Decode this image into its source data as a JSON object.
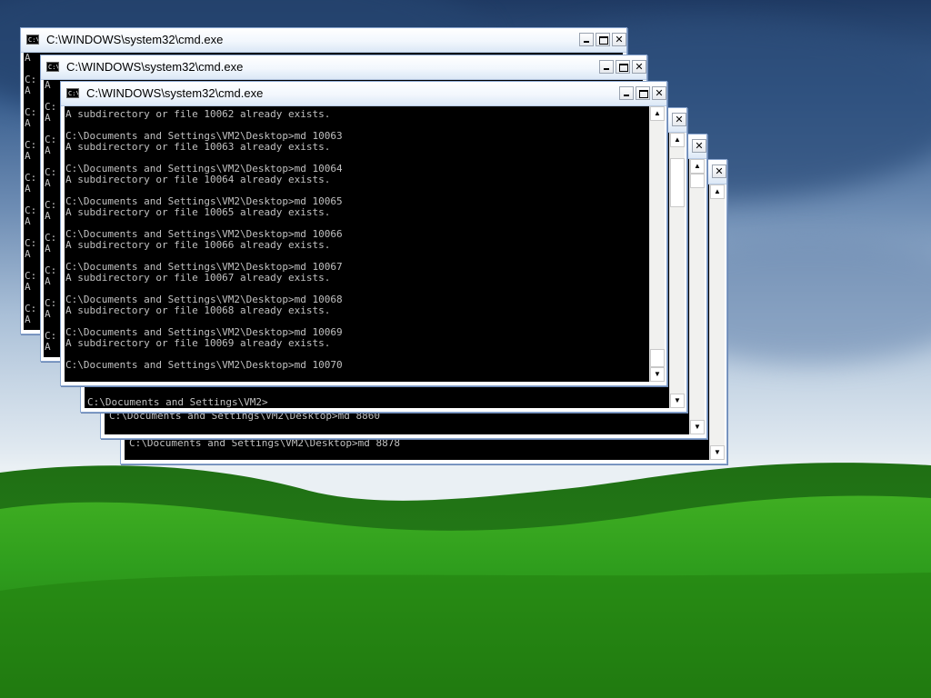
{
  "colors": {
    "desktop_sky": "#3a5f8f",
    "grass": "#2f9e1d",
    "console_bg": "#000000",
    "console_text": "#c0c0c0"
  },
  "icons": {
    "window_icon": "cmd-icon",
    "minimize": "minimize-icon",
    "maximize": "maximize-icon",
    "close": "close-icon",
    "scroll_up": "arrow-up-icon",
    "scroll_down": "arrow-down-icon"
  },
  "windows": [
    {
      "title": "C:\\WINDOWS\\system32\\cmd.exe",
      "icon_text": "C:\\",
      "close_glyph": "✕",
      "up_glyph": "▲",
      "down_glyph": "▼",
      "console": "A\n\nC:\nA\n\nC:\nA\n\nC:\nA\n\nC:\nA\n\nC:\nA\n\nC:\nA\n\nC:\nA\n\nC:\nA\n\nC:"
    },
    {
      "title": "C:\\WINDOWS\\system32\\cmd.exe",
      "icon_text": "C:\\",
      "close_glyph": "✕",
      "up_glyph": "▲",
      "down_glyph": "▼",
      "console": "A\n\nC:\nA\n\nC:\nA\n\nC:\nA\n\nC:\nA\n\nC:\nA\n\nC:\nA\n\nC:\nA\n\nC:\nA\n\nC:"
    },
    {
      "title": "",
      "icon_text": "",
      "close_glyph": "✕",
      "up_glyph": "▲",
      "down_glyph": "▼",
      "console": "C:\\Documents and Settings\\VM2>"
    },
    {
      "title": "",
      "icon_text": "",
      "close_glyph": "✕",
      "up_glyph": "▲",
      "down_glyph": "▼",
      "console": "C:\\Documents and Settings\\VM2\\Desktop>md 8860"
    },
    {
      "title": "",
      "icon_text": "",
      "close_glyph": "✕",
      "up_glyph": "▲",
      "down_glyph": "▼",
      "console": "C:\\Documents and Settings\\VM2\\Desktop>md 8878"
    },
    {
      "title": "C:\\WINDOWS\\system32\\cmd.exe",
      "icon_text": "C:\\",
      "close_glyph": "✕",
      "up_glyph": "▲",
      "down_glyph": "▼",
      "console": "A subdirectory or file 10062 already exists.\n\nC:\\Documents and Settings\\VM2\\Desktop>md 10063\nA subdirectory or file 10063 already exists.\n\nC:\\Documents and Settings\\VM2\\Desktop>md 10064\nA subdirectory or file 10064 already exists.\n\nC:\\Documents and Settings\\VM2\\Desktop>md 10065\nA subdirectory or file 10065 already exists.\n\nC:\\Documents and Settings\\VM2\\Desktop>md 10066\nA subdirectory or file 10066 already exists.\n\nC:\\Documents and Settings\\VM2\\Desktop>md 10067\nA subdirectory or file 10067 already exists.\n\nC:\\Documents and Settings\\VM2\\Desktop>md 10068\nA subdirectory or file 10068 already exists.\n\nC:\\Documents and Settings\\VM2\\Desktop>md 10069\nA subdirectory or file 10069 already exists.\n\nC:\\Documents and Settings\\VM2\\Desktop>md 10070"
    }
  ]
}
